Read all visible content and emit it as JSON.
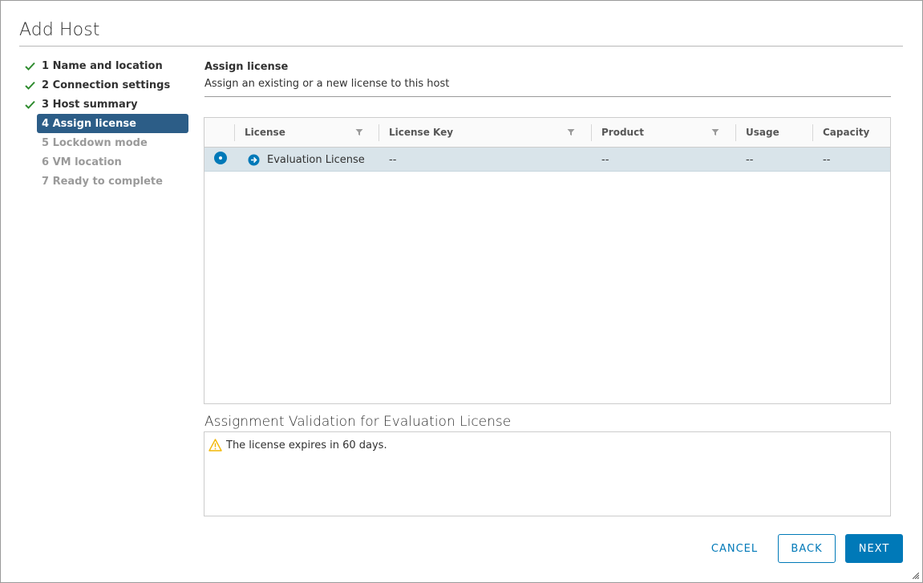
{
  "dialog": {
    "title": "Add Host"
  },
  "steps": [
    {
      "label": "1 Name and location",
      "state": "complete"
    },
    {
      "label": "2 Connection settings",
      "state": "complete"
    },
    {
      "label": "3 Host summary",
      "state": "complete"
    },
    {
      "label": "4 Assign license",
      "state": "active"
    },
    {
      "label": "5 Lockdown mode",
      "state": "pending"
    },
    {
      "label": "6 VM location",
      "state": "pending"
    },
    {
      "label": "7 Ready to complete",
      "state": "pending"
    }
  ],
  "section": {
    "title": "Assign license",
    "subtitle": "Assign an existing or a new license to this host"
  },
  "grid": {
    "columns": [
      "License",
      "License Key",
      "Product",
      "Usage",
      "Capacity"
    ],
    "rows": [
      {
        "license": "Evaluation License",
        "key": "--",
        "product": "--",
        "usage": "--",
        "capacity": "--",
        "selected": true
      }
    ]
  },
  "validation": {
    "title": "Assignment Validation for Evaluation License",
    "message": "The license expires in 60 days."
  },
  "footer": {
    "cancel": "CANCEL",
    "back": "BACK",
    "next": "NEXT"
  },
  "colors": {
    "accent": "#0079b8",
    "active_step": "#2c5d87",
    "selected_row": "#d9e4ea",
    "check": "#2e8b2e",
    "warning": "#f2b705"
  }
}
